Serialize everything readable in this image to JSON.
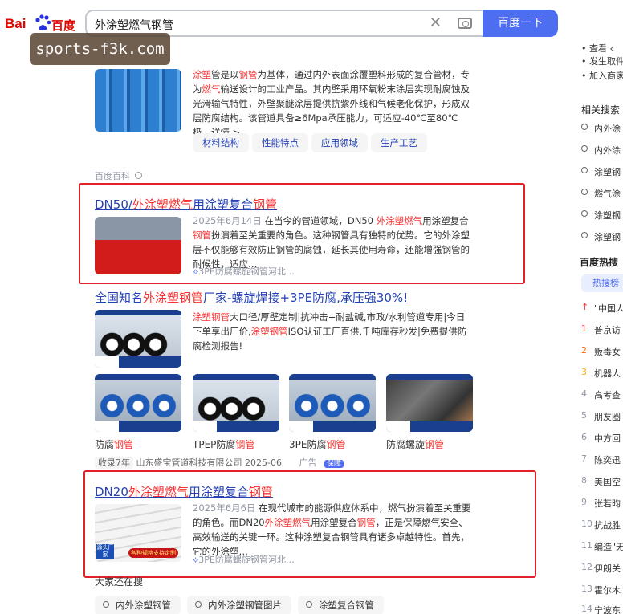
{
  "logo": {
    "brand_left": "Bai",
    "brand_right": "百度"
  },
  "search": {
    "query": "外涂塑燃气钢管",
    "submit_label": "百度一下",
    "clear_glyph": "✕"
  },
  "watermark": "sports-f3k.com",
  "results": {
    "baike": {
      "desc_parts": [
        "涂塑",
        "管是以",
        "钢管",
        "为基体，通过内外表面涂覆塑料形成的复合管材，专为",
        "燃气",
        "输送设计的工业产品。其内壁采用环氧粉末涂层实现耐腐蚀及光滑输气特性，外壁聚醚涂层提供抗紫外线和气候老化保护，形成双层防腐结构。该管道具备≥6Mpa承压能力，可适应-40℃至80℃极…详情 >"
      ],
      "chips": [
        "材料结构",
        "性能特点",
        "应用领域",
        "生产工艺"
      ],
      "source": "百度百科"
    },
    "r1": {
      "title_parts": [
        "DN50/",
        "外涂塑燃气",
        "用涂塑复合",
        "钢管"
      ],
      "date": "2025年6月14日",
      "desc_parts": [
        " 在当今的管道领域，DN50 ",
        "外涂塑燃气",
        "用涂塑复合",
        "钢管",
        "扮演着至关重要的角色。这种钢管具有独特的优势。它的外涂塑层不仅能够有效防止钢管的腐蚀，延长其使用寿命，还能增强钢管的耐候性，适应…"
      ],
      "source": "3PE防腐螺旋钢管河北…"
    },
    "ad": {
      "title_parts": [
        "全国知名",
        "外涂塑钢管",
        "厂家-螺旋焊接+3PE防腐,承压强30%!"
      ],
      "desc_parts": [
        "涂塑钢管",
        "大口径/厚壁定制|抗冲击+耐盐碱,市政/水利管道专用|今日下单享出厂价,",
        "涂塑钢管",
        "ISO认证工厂直供,千吨库存秒发|免费提供防腐检测报告!"
      ],
      "captions": [
        {
          "a": "防腐",
          "b": "钢管"
        },
        {
          "a": "TPEP防腐",
          "b": "钢管"
        },
        {
          "a": "3PE防腐",
          "b": "钢管"
        },
        {
          "a": "防腐螺旋",
          "b": "钢管"
        }
      ],
      "years_badge": "收录7年",
      "company": "山东盛宝管道科技有限公司 2025-06",
      "ad_label": "广告",
      "guarantee": "保障"
    },
    "r2": {
      "title_parts": [
        "DN20",
        "外涂塑燃气",
        "用涂塑复合",
        "钢管"
      ],
      "date": "2025年6月6日",
      "desc_parts": [
        " 在现代城市的能源供应体系中，燃气扮演着至关重要的角色。而DN20",
        "外涂塑燃气",
        "用涂塑复合",
        "钢管",
        "，正是保障燃气安全、高效输送的关键一环。这种涂塑复合钢管具有诸多卓越特性。首先，它的外涂塑…"
      ],
      "source": "3PE防腐螺旋钢管河北…",
      "thumb_badge": "源头厂家",
      "thumb_tag": "各种规格支持定制"
    }
  },
  "related_bottom": {
    "heading": "大家还在搜",
    "items": [
      "内外涂塑钢管",
      "内外涂塑钢管图片",
      "涂塑复合钢管"
    ]
  },
  "sidebar": {
    "top_lines": [
      "• 查看 ‹",
      "• 发生取件",
      "• 加入商家"
    ],
    "related_heading": "相关搜索",
    "related": [
      "内外涂",
      "内外涂",
      "涂塑钢",
      "燃气涂",
      "涂塑钢",
      "涂塑钢"
    ],
    "hot_heading": "百度热搜",
    "hot_tab": "热搜榜",
    "hot": [
      {
        "rank": "↑",
        "text": "\"中国人"
      },
      {
        "rank": "1",
        "text": "普京访"
      },
      {
        "rank": "2",
        "text": "贩毒女"
      },
      {
        "rank": "3",
        "text": "机器人"
      },
      {
        "rank": "4",
        "text": "高考查"
      },
      {
        "rank": "5",
        "text": "朋友圈"
      },
      {
        "rank": "6",
        "text": "中方回"
      },
      {
        "rank": "7",
        "text": "陈奕迅"
      },
      {
        "rank": "8",
        "text": "美国空"
      },
      {
        "rank": "9",
        "text": "张若昀"
      },
      {
        "rank": "10",
        "text": "抗战胜"
      },
      {
        "rank": "11",
        "text": "编造\"无"
      },
      {
        "rank": "12",
        "text": "伊朗关"
      },
      {
        "rank": "13",
        "text": "霍尔木"
      },
      {
        "rank": "14",
        "text": "宁波东"
      }
    ]
  },
  "colors": {
    "brand": "#e10601",
    "link": "#2440b3",
    "highlight": "#f73131",
    "button": "#4e6ef2",
    "annotation_box": "#e0212a"
  }
}
